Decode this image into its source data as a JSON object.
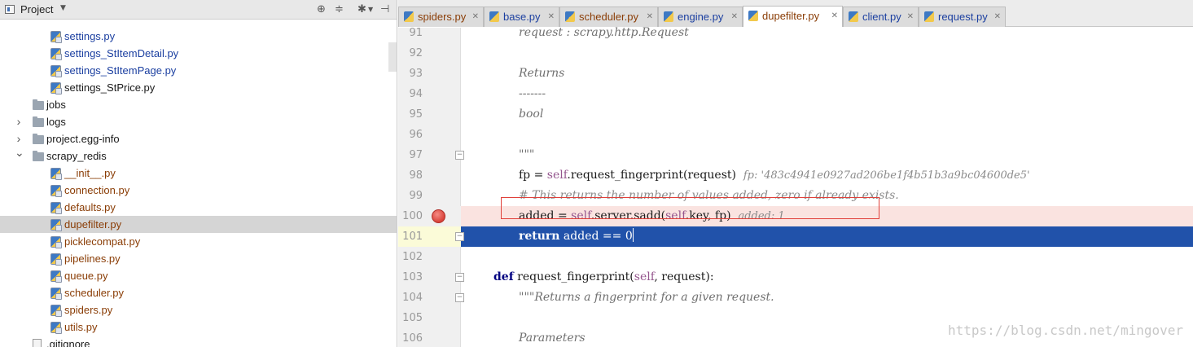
{
  "project": {
    "title": "Project",
    "tree": [
      {
        "label": "settings.py",
        "kind": "py",
        "depth": 3
      },
      {
        "label": "settings_StItemDetail.py",
        "kind": "py",
        "depth": 3
      },
      {
        "label": "settings_StItemPage.py",
        "kind": "py",
        "depth": 3
      },
      {
        "label": "settings_StPrice.py",
        "kind": "py-dark",
        "depth": 3
      },
      {
        "label": "jobs",
        "kind": "folder",
        "depth": 2
      },
      {
        "label": "logs",
        "kind": "folder-collapsed",
        "depth": 2
      },
      {
        "label": "project.egg-info",
        "kind": "folder-collapsed",
        "depth": 2
      },
      {
        "label": "scrapy_redis",
        "kind": "folder-expanded",
        "depth": 2
      },
      {
        "label": "__init__.py",
        "kind": "py-vcs",
        "depth": 3
      },
      {
        "label": "connection.py",
        "kind": "py-vcs",
        "depth": 3
      },
      {
        "label": "defaults.py",
        "kind": "py-vcs",
        "depth": 3
      },
      {
        "label": "dupefilter.py",
        "kind": "py-vcs",
        "depth": 3,
        "selected": true
      },
      {
        "label": "picklecompat.py",
        "kind": "py-vcs",
        "depth": 3
      },
      {
        "label": "pipelines.py",
        "kind": "py-vcs",
        "depth": 3
      },
      {
        "label": "queue.py",
        "kind": "py-vcs",
        "depth": 3
      },
      {
        "label": "scheduler.py",
        "kind": "py-vcs",
        "depth": 3
      },
      {
        "label": "spiders.py",
        "kind": "py-vcs",
        "depth": 3
      },
      {
        "label": "utils.py",
        "kind": "py-vcs",
        "depth": 3
      },
      {
        "label": ".gitignore",
        "kind": "file",
        "depth": 2
      }
    ]
  },
  "tabs": [
    {
      "label": "spiders.py",
      "vcs": true
    },
    {
      "label": "base.py",
      "vcs": false
    },
    {
      "label": "scheduler.py",
      "vcs": true
    },
    {
      "label": "engine.py",
      "vcs": false
    },
    {
      "label": "dupefilter.py",
      "vcs": true,
      "active": true
    },
    {
      "label": "client.py",
      "vcs": false
    },
    {
      "label": "request.py",
      "vcs": false
    }
  ],
  "editor": {
    "lines": [
      {
        "num": "91",
        "tokens": [
          {
            "t": "request : scrapy.http.Request",
            "c": "doc"
          }
        ],
        "indent": 2
      },
      {
        "num": "92",
        "tokens": [],
        "indent": 2
      },
      {
        "num": "93",
        "tokens": [
          {
            "t": "Returns",
            "c": "doc"
          }
        ],
        "indent": 2
      },
      {
        "num": "94",
        "tokens": [
          {
            "t": "-------",
            "c": "doc"
          }
        ],
        "indent": 2
      },
      {
        "num": "95",
        "tokens": [
          {
            "t": "bool",
            "c": "doc"
          }
        ],
        "indent": 2
      },
      {
        "num": "96",
        "tokens": [],
        "indent": 2
      },
      {
        "num": "97",
        "tokens": [
          {
            "t": "\"\"\"",
            "c": "doc"
          }
        ],
        "indent": 2,
        "fold": true
      },
      {
        "num": "98",
        "tokens": [
          {
            "t": "fp = ",
            "c": "plain"
          },
          {
            "t": "self",
            "c": "self"
          },
          {
            "t": ".request_fingerprint(request)  ",
            "c": "plain"
          },
          {
            "t": "fp: '483c4941e0927ad206be1f4b51b3a9bc04600de5'",
            "c": "hint"
          }
        ],
        "indent": 2
      },
      {
        "num": "99",
        "tokens": [
          {
            "t": "# This returns the number of values added, zero if already exists.",
            "c": "comment"
          }
        ],
        "indent": 2
      },
      {
        "num": "100",
        "tokens": [
          {
            "t": "added = ",
            "c": "plain"
          },
          {
            "t": "self",
            "c": "self"
          },
          {
            "t": ".server.sadd(",
            "c": "plain"
          },
          {
            "t": "self",
            "c": "self"
          },
          {
            "t": ".key, fp)  ",
            "c": "plain"
          },
          {
            "t": "added: 1",
            "c": "hint"
          }
        ],
        "indent": 2,
        "breakpoint": true
      },
      {
        "num": "101",
        "tokens": [
          {
            "t": "return",
            "c": "kw"
          },
          {
            "t": " added == 0",
            "c": "plain"
          }
        ],
        "indent": 2,
        "exec": true,
        "fold": true
      },
      {
        "num": "102",
        "tokens": [],
        "indent": 2
      },
      {
        "num": "103",
        "tokens": [
          {
            "t": "def",
            "c": "kw"
          },
          {
            "t": " request_fingerprint(",
            "c": "plain"
          },
          {
            "t": "self",
            "c": "self"
          },
          {
            "t": ", request):",
            "c": "plain"
          }
        ],
        "indent": 1,
        "fold": true
      },
      {
        "num": "104",
        "tokens": [
          {
            "t": "\"\"\"Returns a fingerprint for a given request.",
            "c": "doc"
          }
        ],
        "indent": 2,
        "fold": true
      },
      {
        "num": "105",
        "tokens": [],
        "indent": 2
      },
      {
        "num": "106",
        "tokens": [
          {
            "t": "Parameters",
            "c": "doc"
          }
        ],
        "indent": 2
      }
    ]
  },
  "watermark": "https://blog.csdn.net/mingover",
  "colors": {
    "execution_line": "#2152aa",
    "breakpoint_line": "#fae3e0",
    "breakpoint": "#d9423a",
    "keyword": "#000080",
    "self": "#94558d"
  }
}
